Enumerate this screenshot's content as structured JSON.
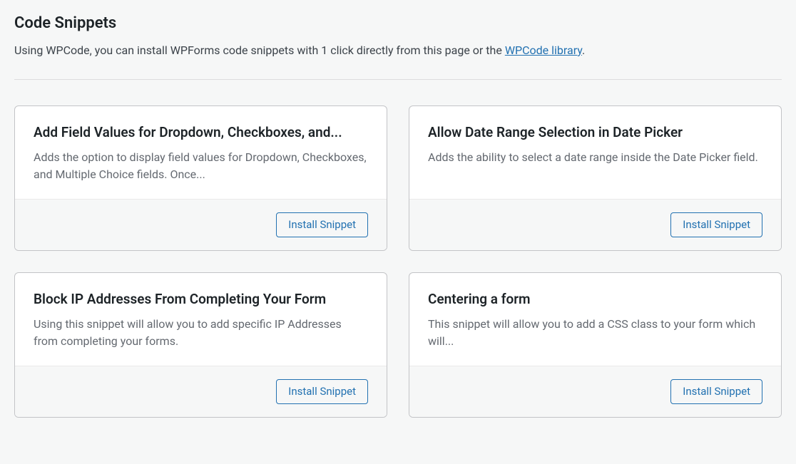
{
  "header": {
    "title": "Code Snippets",
    "intro_prefix": "Using WPCode, you can install WPForms code snippets with 1 click directly from this page or the ",
    "intro_link": "WPCode library",
    "intro_suffix": "."
  },
  "button_label": "Install Snippet",
  "snippets": [
    {
      "title": "Add Field Values for Dropdown, Checkboxes, and...",
      "description": "Adds the option to display field values for Dropdown, Checkboxes, and Multiple Choice fields. Once..."
    },
    {
      "title": "Allow Date Range Selection in Date Picker",
      "description": "Adds the ability to select a date range inside the Date Picker field."
    },
    {
      "title": "Block IP Addresses From Completing Your Form",
      "description": "Using this snippet will allow you to add specific IP Addresses from completing your forms."
    },
    {
      "title": "Centering a form",
      "description": "This snippet will allow you to add a CSS class to your form which will..."
    }
  ]
}
